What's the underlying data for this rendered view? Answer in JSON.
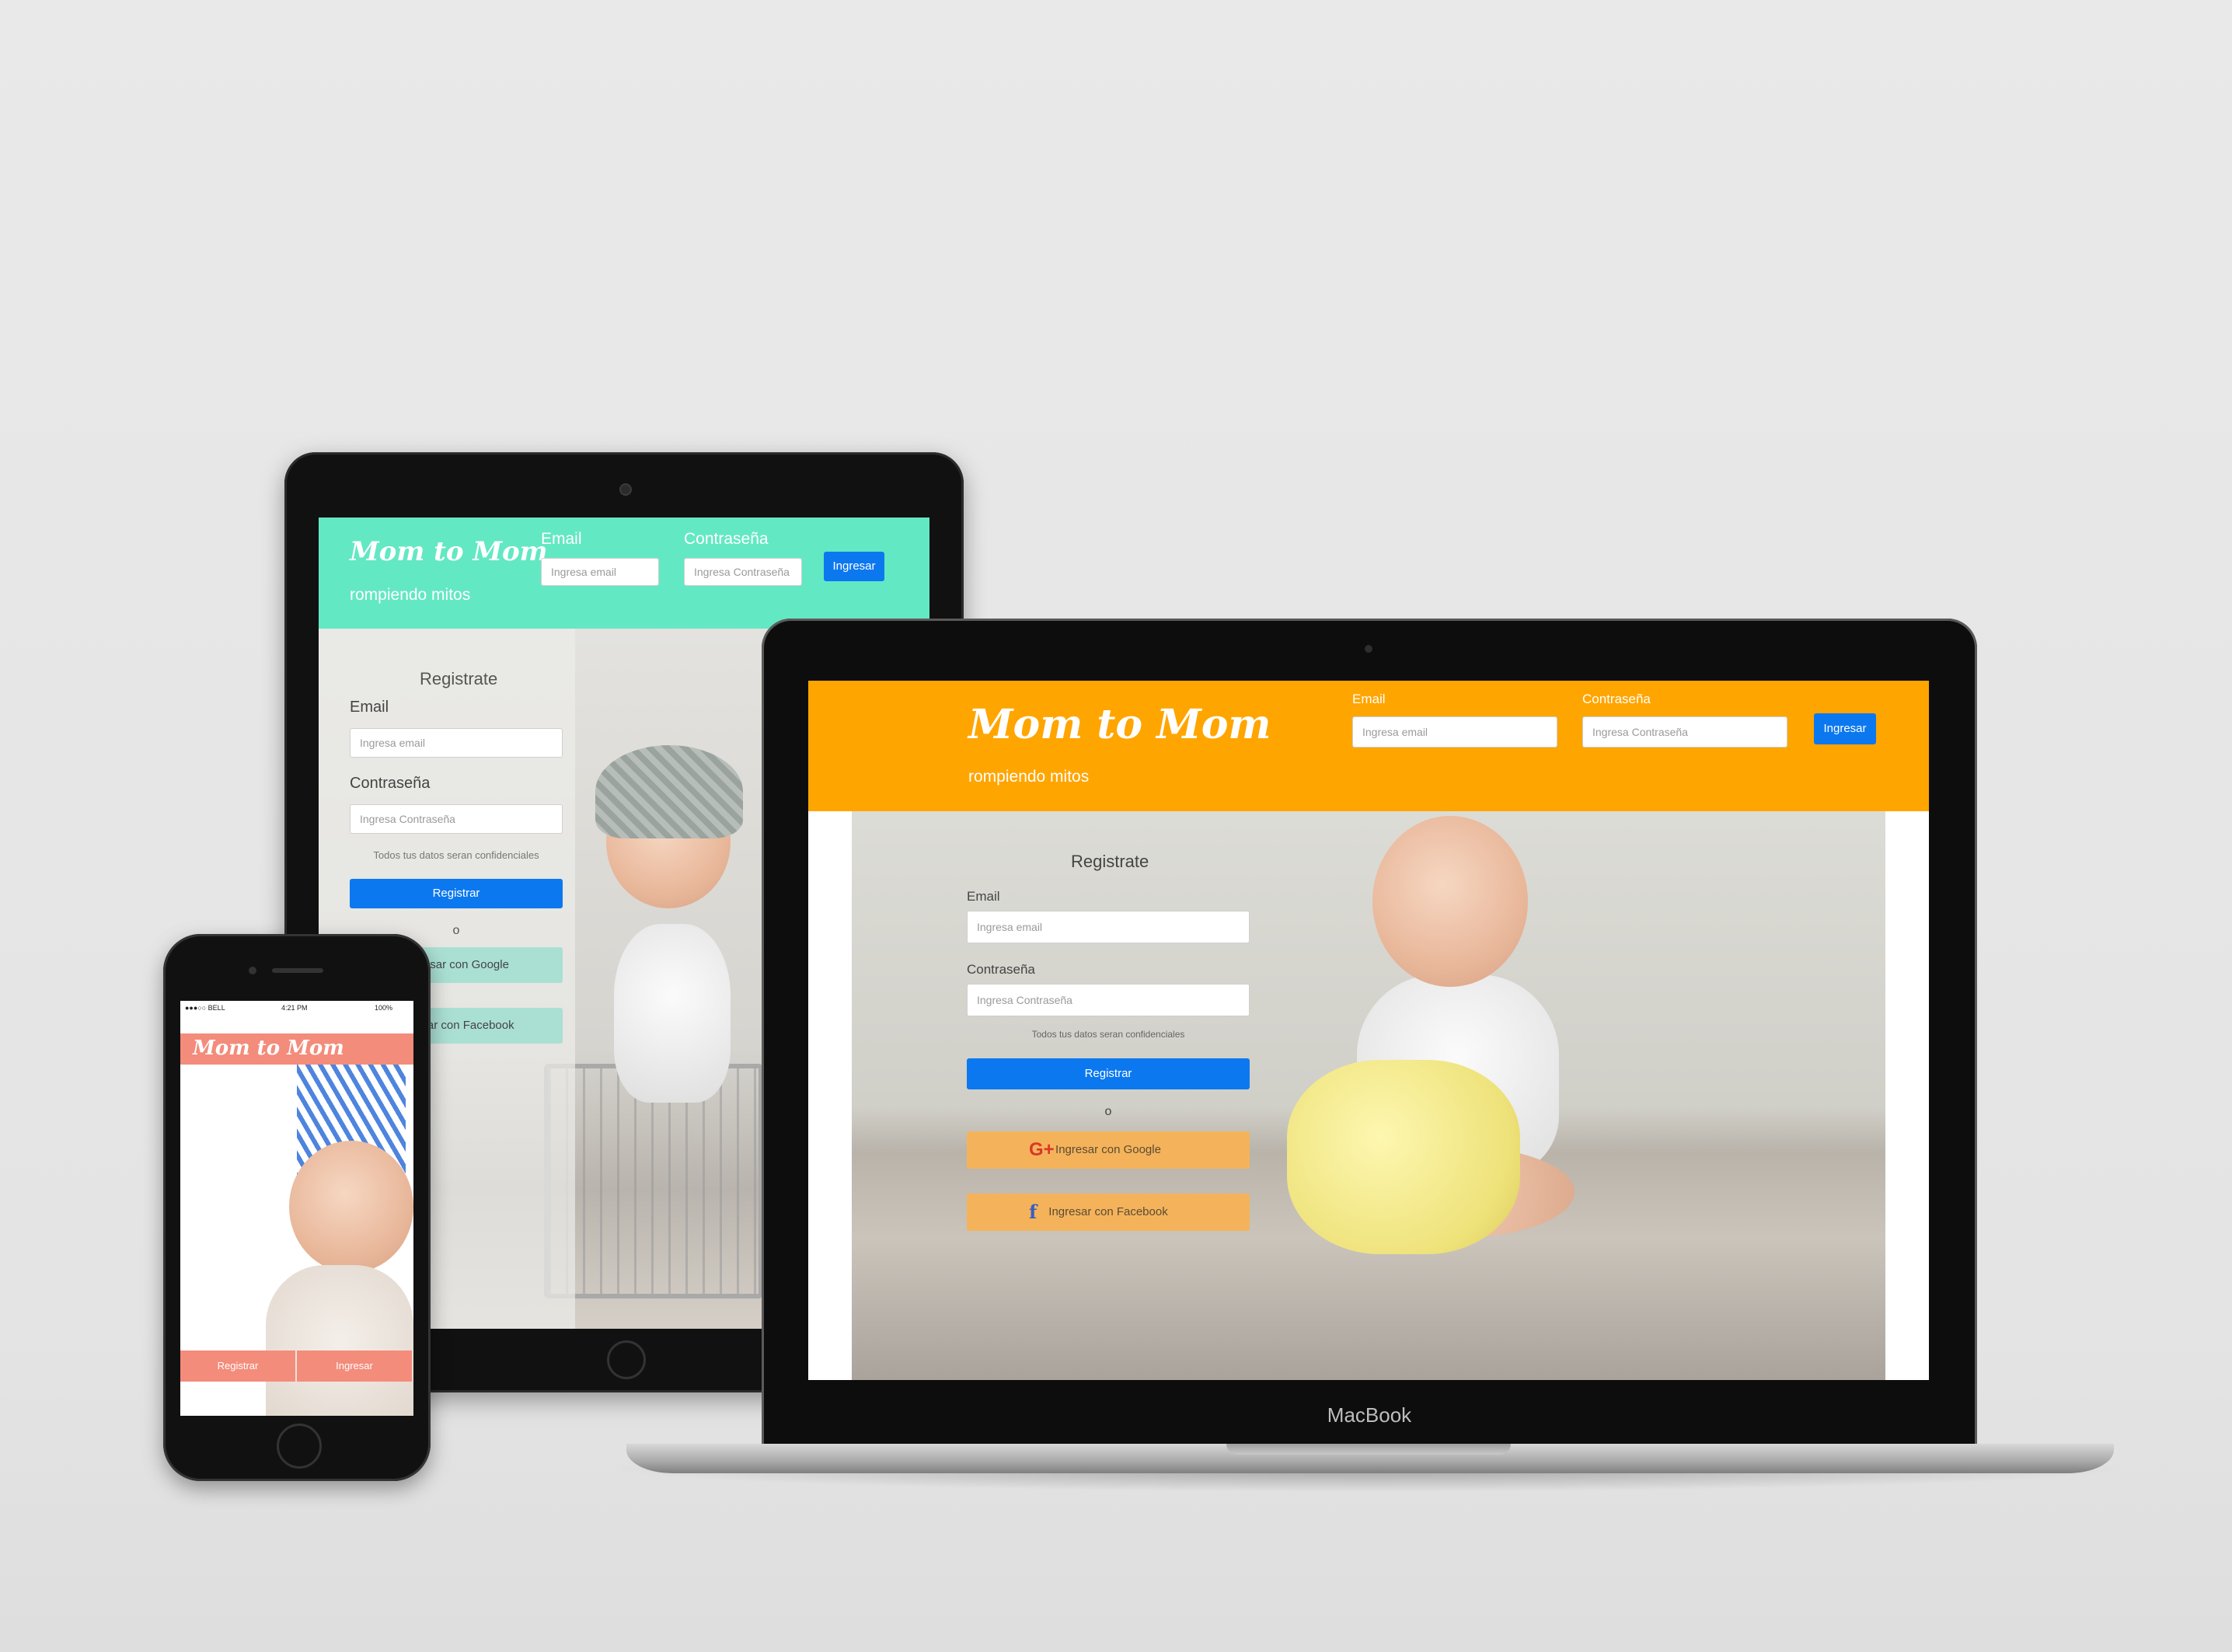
{
  "app": {
    "logo": "Mom to Mom",
    "tagline": "rompiendo mitos"
  },
  "login": {
    "email_label": "Email",
    "email_placeholder": "Ingresa email",
    "password_label": "Contraseña",
    "password_placeholder": "Ingresa Contraseña",
    "submit_label": "Ingresar"
  },
  "register": {
    "title": "Registrate",
    "email_label": "Email",
    "email_placeholder": "Ingresa email",
    "password_label": "Contraseña",
    "password_placeholder": "Ingresa Contraseña",
    "privacy_note": "Todos tus datos seran confidenciales",
    "submit_label": "Registrar",
    "or_label": "o",
    "google_label": "Ingresar con Google",
    "facebook_label": "Ingresar con Facebook",
    "google_icon": "google-plus-icon",
    "facebook_icon": "facebook-icon"
  },
  "tablet": {
    "google_label": "Ingresar con Google",
    "facebook_label": "ngresar con Facebook"
  },
  "phone": {
    "status": {
      "carrier": "●●●○○ BELL",
      "time": "4:21 PM",
      "battery": "100%"
    },
    "register_label": "Registrar",
    "login_label": "Ingresar"
  },
  "device": {
    "laptop_brand": "MacBook"
  },
  "colors": {
    "laptop_header": "#ffa500",
    "tablet_header": "#63e8c4",
    "phone_header": "#f38c7b",
    "primary_button": "#0c78f0"
  }
}
